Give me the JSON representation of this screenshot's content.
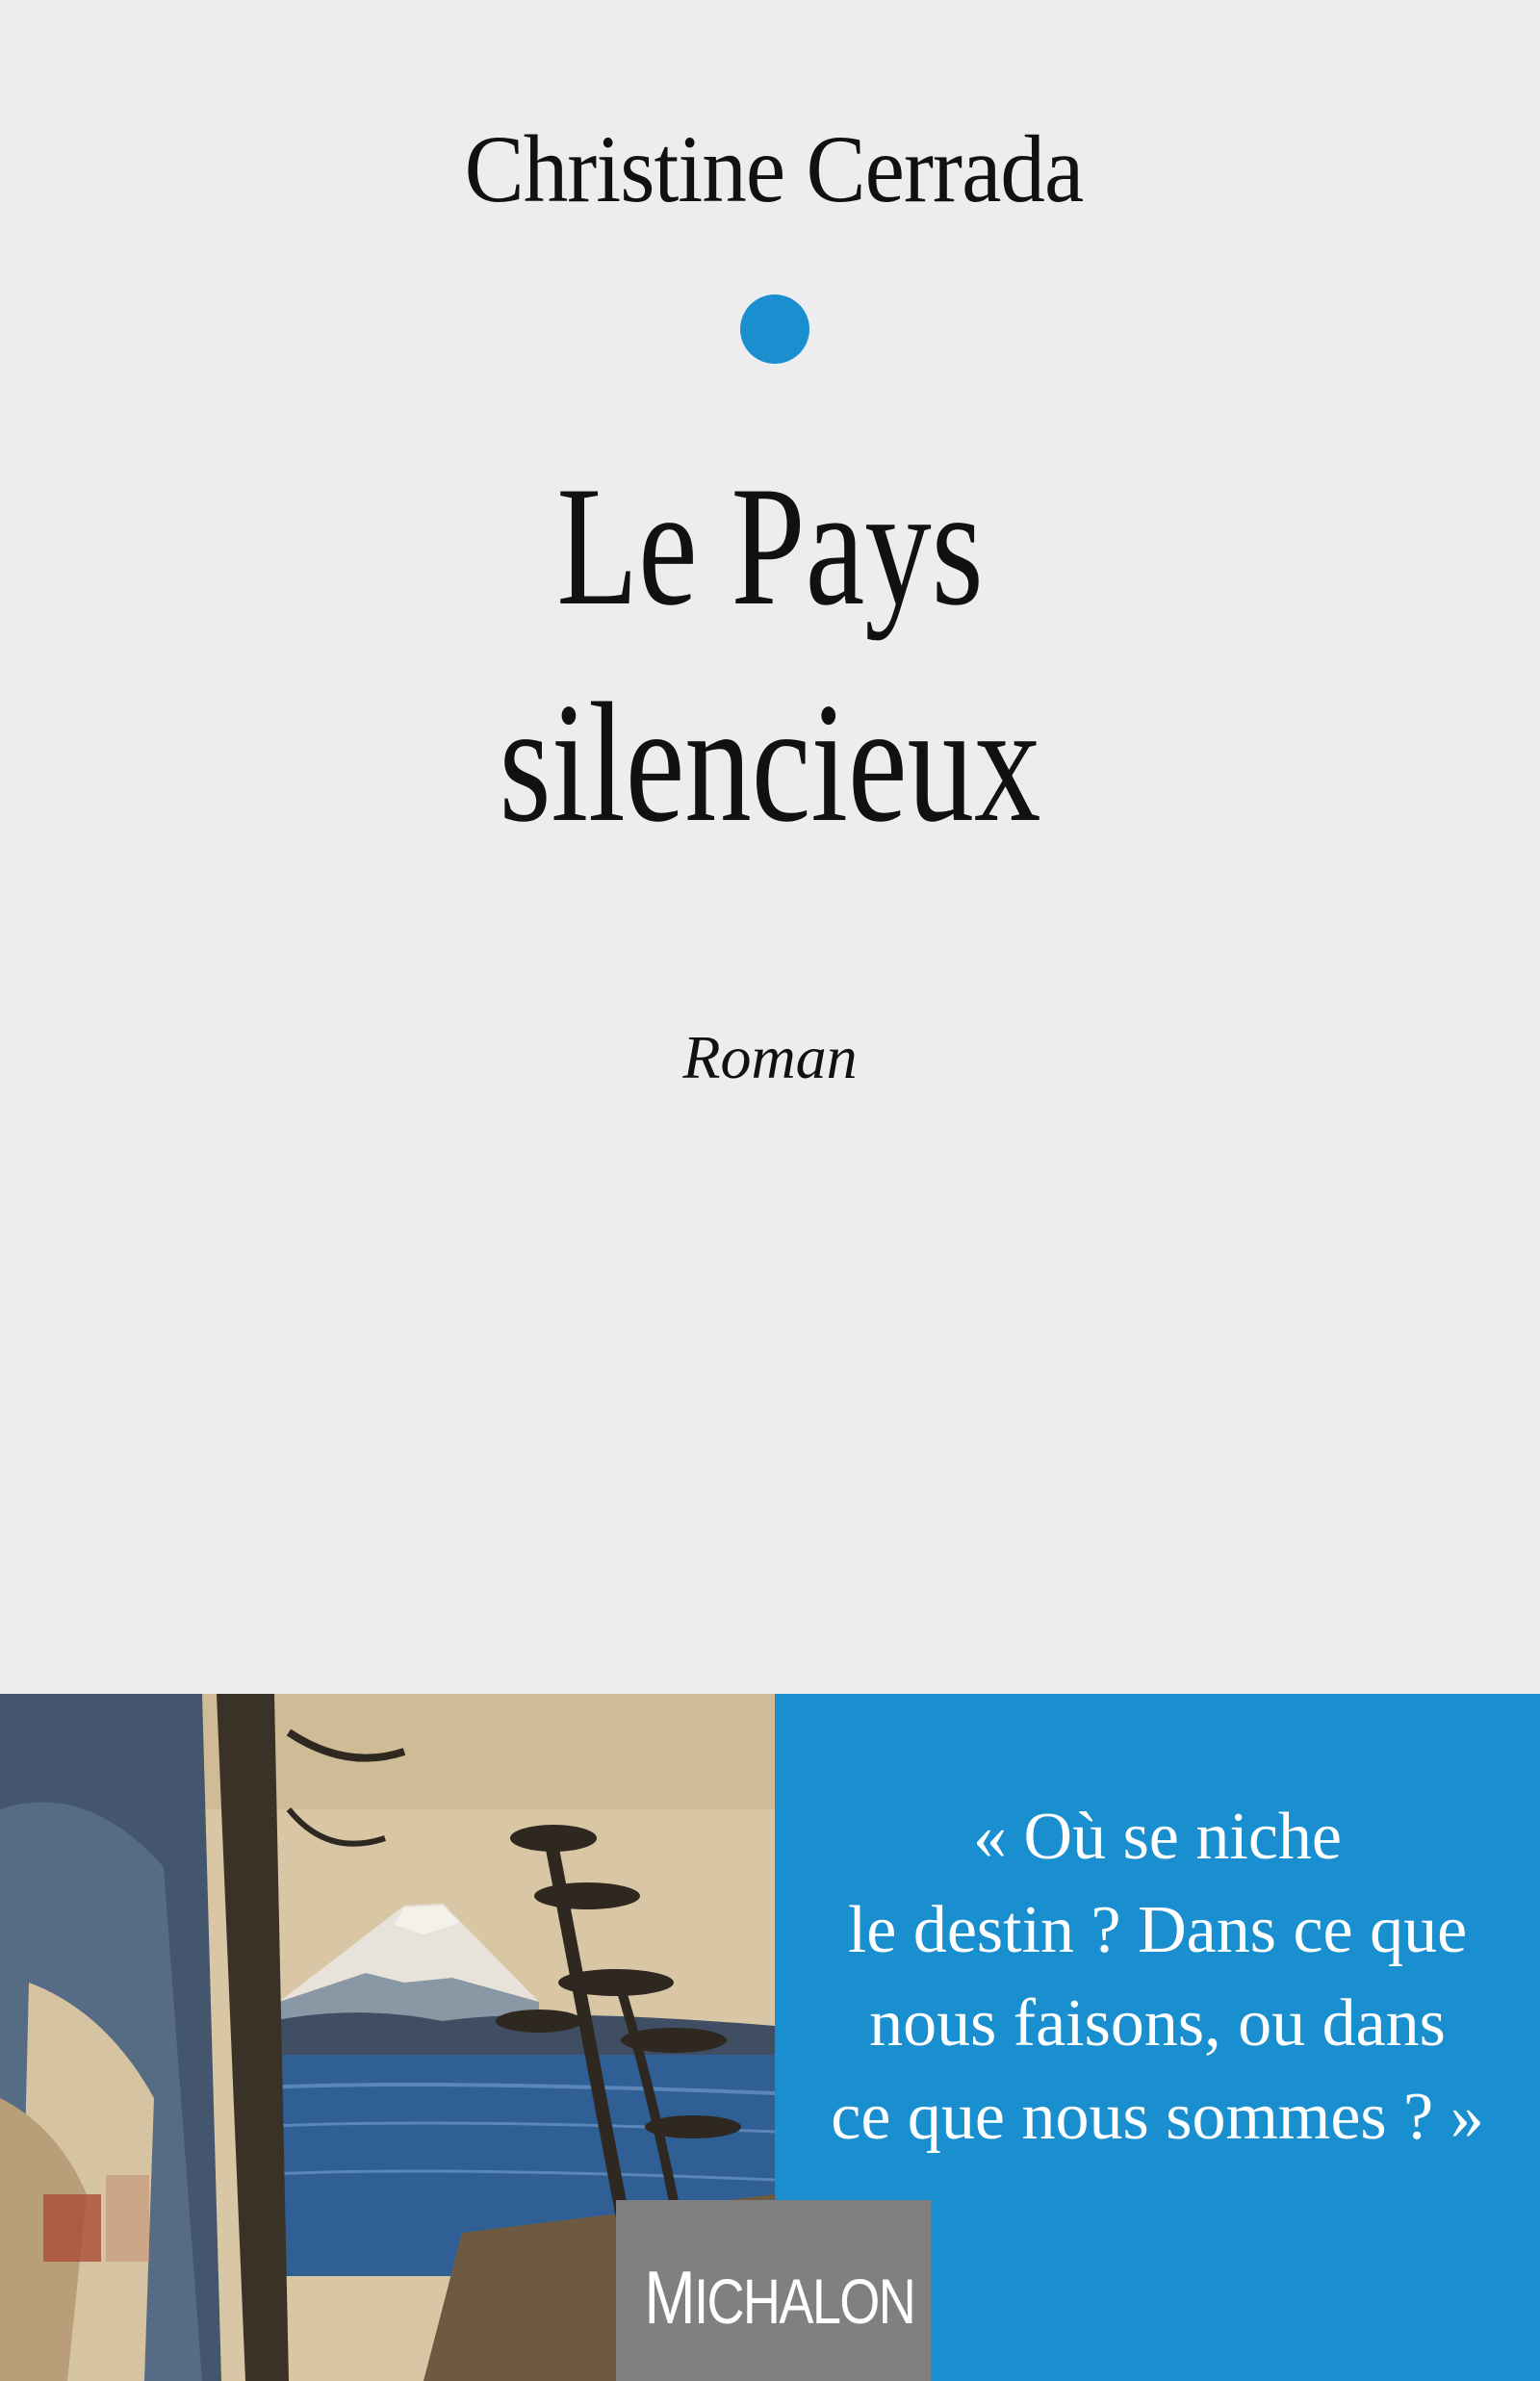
{
  "cover": {
    "author": "Christine Cerrada",
    "title_lines": [
      "Le Pays",
      "silencieux"
    ],
    "genre": "Roman",
    "quote_lines": [
      "« Où se niche",
      "le destin ? Dans ce que",
      "nous faisons, ou dans",
      "ce que nous sommes ? »"
    ],
    "publisher": {
      "first": "M",
      "rest": "ICHALON"
    },
    "artwork": "ukiyo-e print of mount fuji and pine trees"
  },
  "colors": {
    "background": "#ededef",
    "accent_blue": "#1a8fd0",
    "publisher_gray": "#808080",
    "text": "#111111"
  }
}
